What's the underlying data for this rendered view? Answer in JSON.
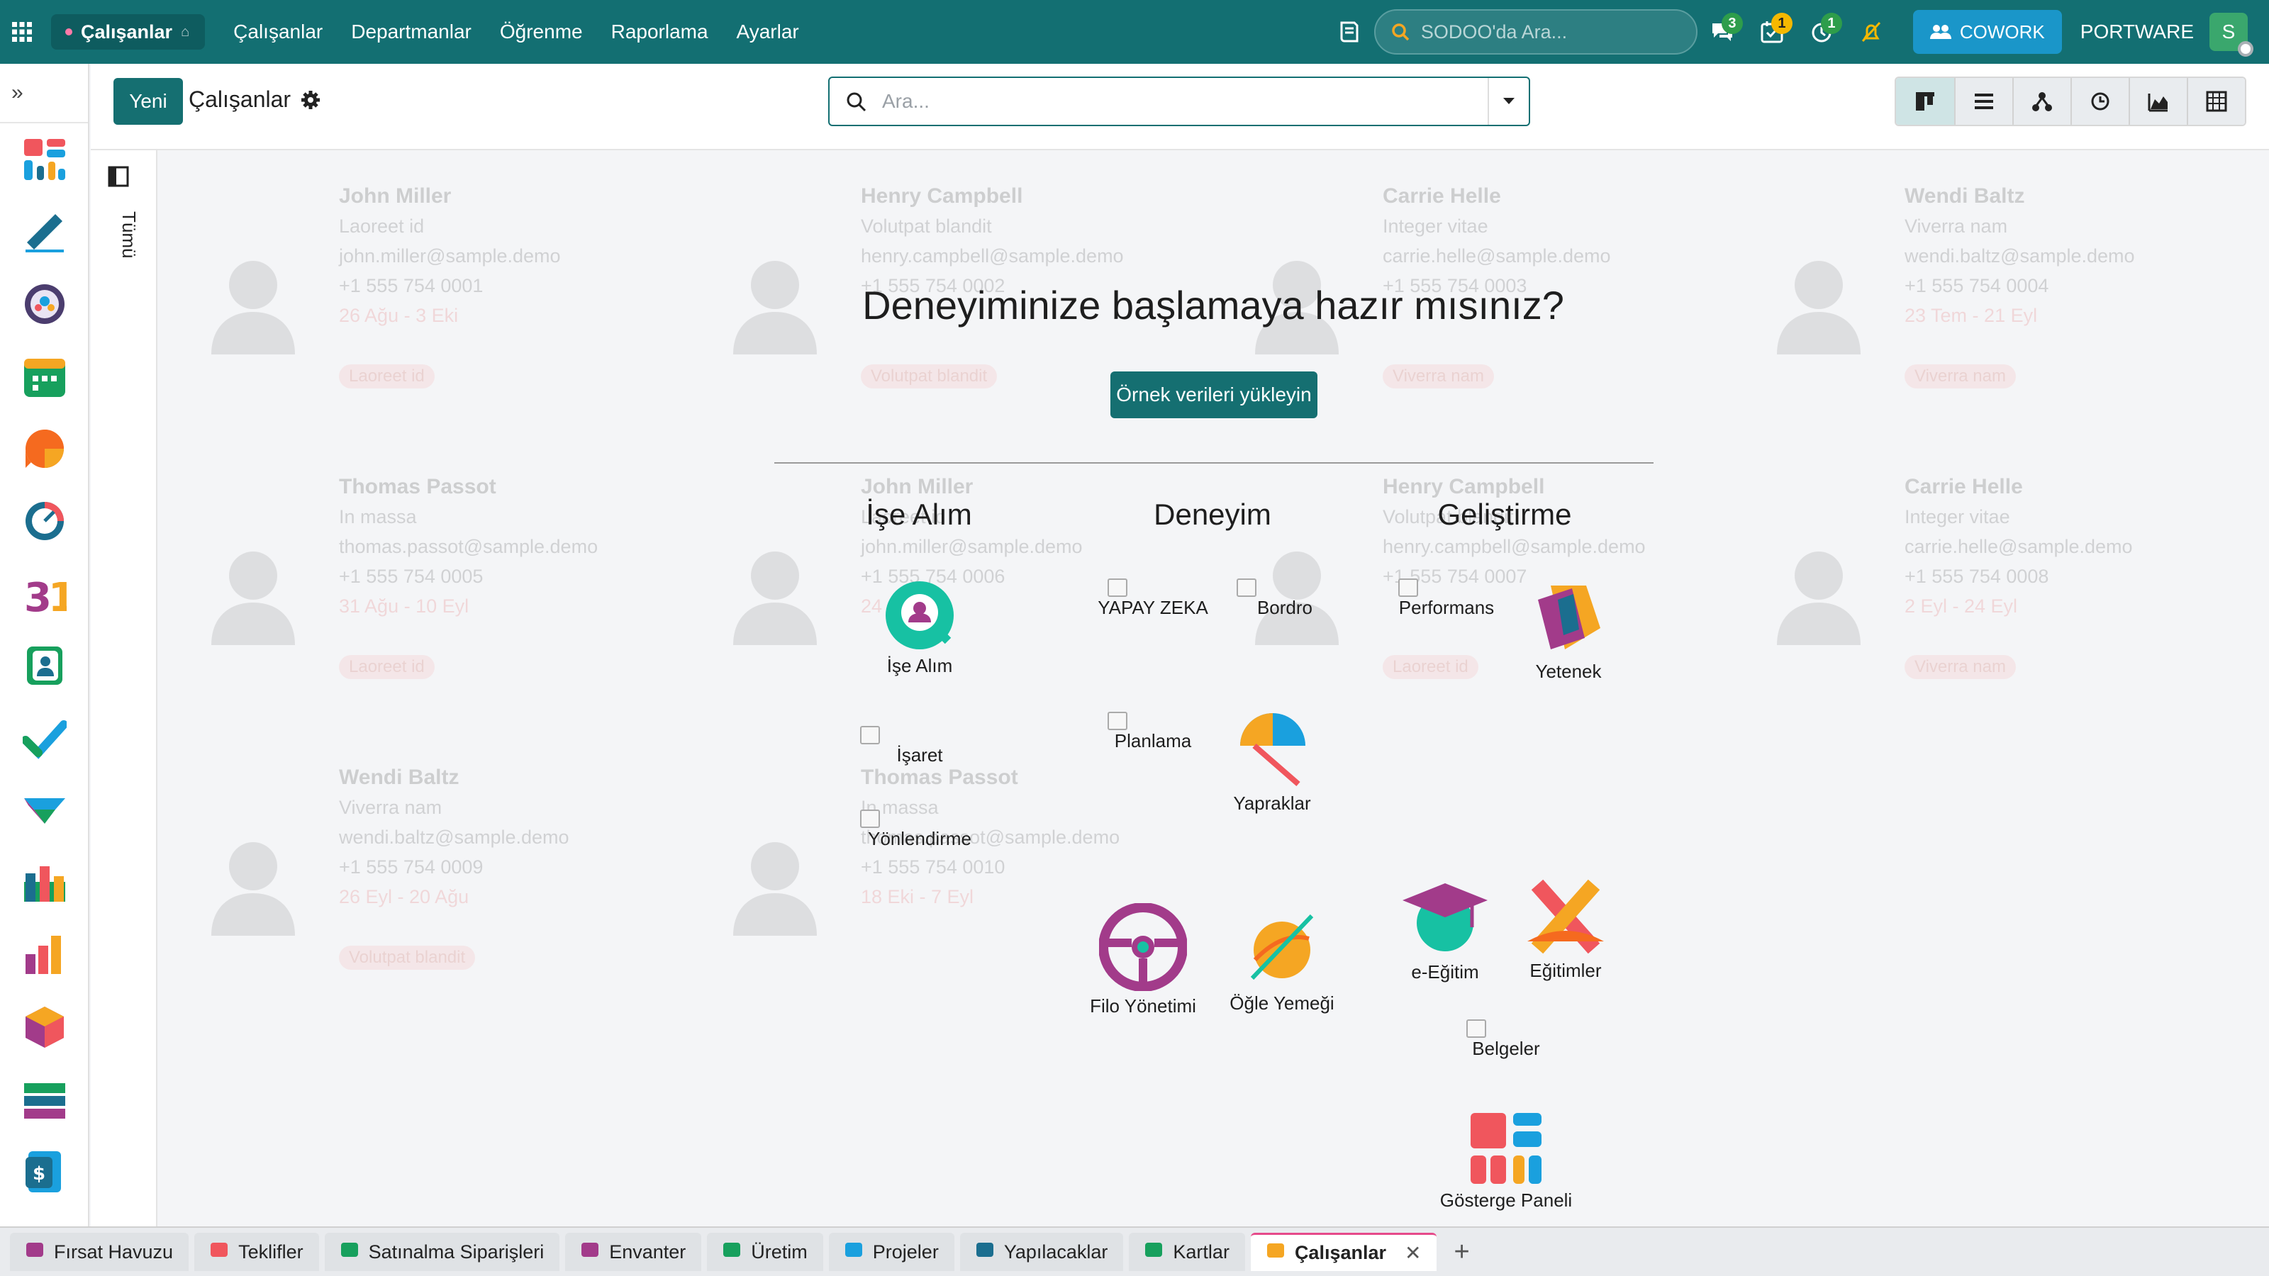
{
  "topbar": {
    "app_name": "Çalışanlar",
    "menu": [
      "Çalışanlar",
      "Departmanlar",
      "Öğrenme",
      "Raporlama",
      "Ayarlar"
    ],
    "search_placeholder": "SODOO'da Ara...",
    "badges": {
      "chat": "3",
      "activities": "1",
      "timer": "1"
    },
    "cowork_label": "COWORK",
    "company": "PORTWARE",
    "user_initial": "S",
    "colors": {
      "bar": "#136f72",
      "cowork": "#1a96c9",
      "badge_green": "#2e9d4b",
      "badge_yellow": "#f5b800"
    }
  },
  "control": {
    "new_label": "Yeni",
    "title": "Çalışanlar",
    "search_placeholder": "Ara...",
    "views": [
      "kanban",
      "list",
      "hierarchy",
      "activity",
      "graph",
      "pivot"
    ]
  },
  "panel": {
    "label": "Tümü"
  },
  "sample_cards": [
    {
      "name": "John Miller",
      "job": "Laoreet id",
      "email": "john.miller@sample.demo",
      "phone": "+1 555 754 0001",
      "dates": "26 Ağu - 3 Eki",
      "tag": "Laoreet id"
    },
    {
      "name": "Henry Campbell",
      "job": "Volutpat blandit",
      "email": "henry.campbell@sample.demo",
      "phone": "+1 555 754 0002",
      "dates": "",
      "tag": "Volutpat blandit"
    },
    {
      "name": "Carrie Helle",
      "job": "Integer vitae",
      "email": "carrie.helle@sample.demo",
      "phone": "+1 555 754 0003",
      "dates": "",
      "tag": "Viverra nam"
    },
    {
      "name": "Wendi Baltz",
      "job": "Viverra nam",
      "email": "wendi.baltz@sample.demo",
      "phone": "+1 555 754 0004",
      "dates": "23 Tem - 21 Eyl",
      "tag": "Viverra nam"
    },
    {
      "name": "Thomas Passot",
      "job": "In massa",
      "email": "thomas.passot@sample.demo",
      "phone": "+1 555 754 0005",
      "dates": "31 Ağu - 10 Eyl",
      "tag": "Laoreet id"
    },
    {
      "name": "John Miller",
      "job": "Laoreet id",
      "email": "john.miller@sample.demo",
      "phone": "+1 555 754 0006",
      "dates": "24 Ağu",
      "tag": ""
    },
    {
      "name": "Henry Campbell",
      "job": "Volutpat blandit",
      "email": "henry.campbell@sample.demo",
      "phone": "+1 555 754 0007",
      "dates": "",
      "tag": "Laoreet id"
    },
    {
      "name": "Carrie Helle",
      "job": "Integer vitae",
      "email": "carrie.helle@sample.demo",
      "phone": "+1 555 754 0008",
      "dates": "2 Eyl - 24 Eyl",
      "tag": "Viverra nam"
    },
    {
      "name": "Wendi Baltz",
      "job": "Viverra nam",
      "email": "wendi.baltz@sample.demo",
      "phone": "+1 555 754 0009",
      "dates": "26 Eyl - 20 Ağu",
      "tag": "Volutpat blandit"
    },
    {
      "name": "Thomas Passot",
      "job": "In massa",
      "email": "thomas.passot@sample.demo",
      "phone": "+1 555 754 0010",
      "dates": "18 Eki - 7 Eyl",
      "tag": ""
    }
  ],
  "onboarding": {
    "headline": "Deneyiminize başlamaya hazır mısınız?",
    "load_button": "Örnek verileri yükleyin",
    "columns": [
      "İşe Alım",
      "Deneyim",
      "Geliştirme"
    ],
    "apps": {
      "recruitment": "İşe Alım",
      "sign": "İşaret",
      "referral": "Yönlendirme",
      "ai": "YAPAY ZEKA",
      "payroll": "Bordro",
      "planning": "Planlama",
      "timeoff": "Yapraklar",
      "fleet": "Filo Yönetimi",
      "lunch": "Öğle Yemeği",
      "appraisal": "Performans",
      "skills": "Yetenek",
      "elearning": "e-Eğitim",
      "trainings": "Eğitimler",
      "documents": "Belgeler",
      "dashboard": "Gösterge Paneli"
    }
  },
  "bottom_tabs": [
    {
      "label": "Fırsat Havuzu",
      "icon": "crm-icon"
    },
    {
      "label": "Teklifler",
      "icon": "sales-icon"
    },
    {
      "label": "Satınalma Siparişleri",
      "icon": "purchase-icon"
    },
    {
      "label": "Envanter",
      "icon": "inventory-icon"
    },
    {
      "label": "Üretim",
      "icon": "manufacturing-icon"
    },
    {
      "label": "Projeler",
      "icon": "project-icon"
    },
    {
      "label": "Yapılacaklar",
      "icon": "todo-icon"
    },
    {
      "label": "Kartlar",
      "icon": "cards-icon"
    },
    {
      "label": "Çalışanlar",
      "icon": "employees-icon",
      "active": true
    }
  ]
}
